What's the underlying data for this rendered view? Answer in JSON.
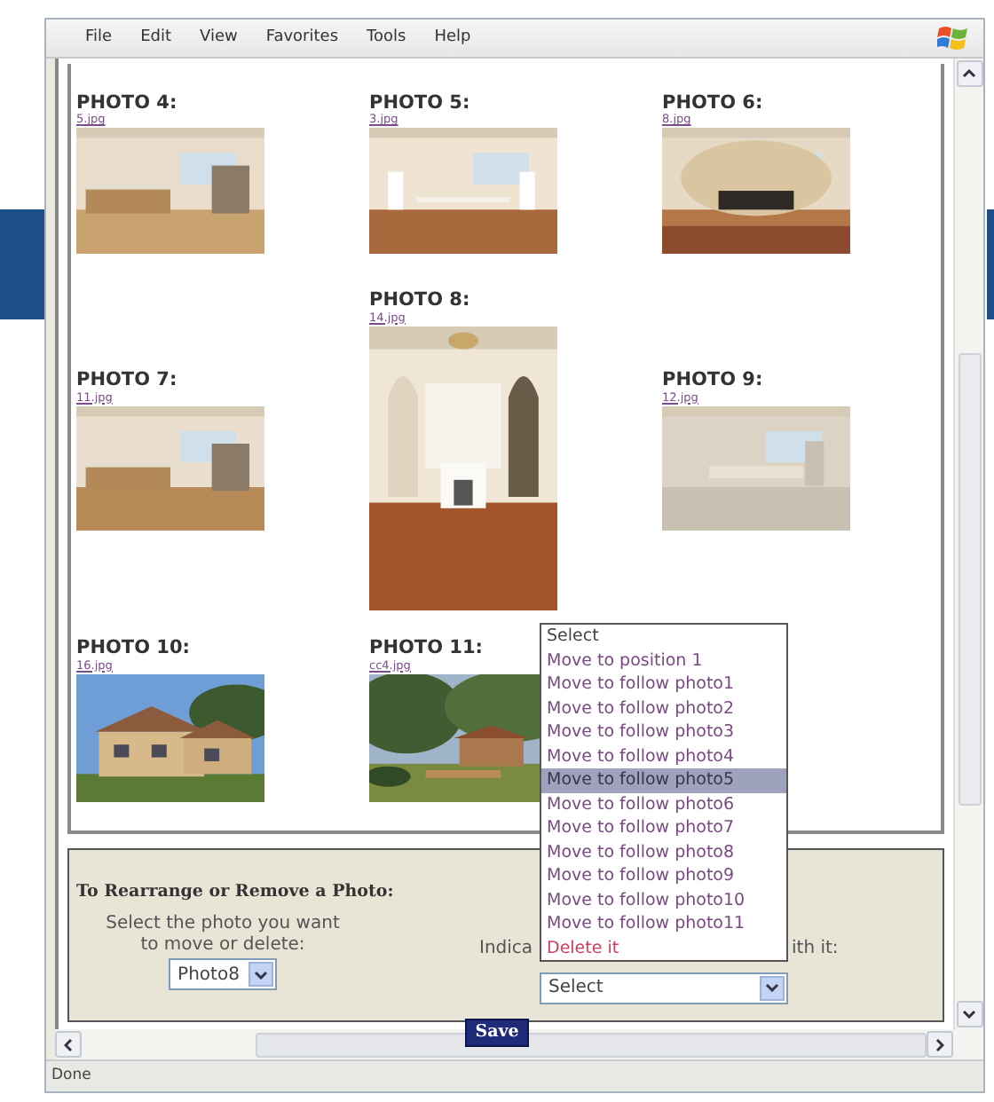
{
  "menu": [
    "File",
    "Edit",
    "View",
    "Favorites",
    "Tools",
    "Help"
  ],
  "photos": [
    {
      "title": "PHOTO 4:",
      "file": "5.jpg"
    },
    {
      "title": "PHOTO 5:",
      "file": "3.jpg"
    },
    {
      "title": "PHOTO 6:",
      "file": "8.jpg"
    },
    {
      "title": "PHOTO 7:",
      "file": "11.jpg"
    },
    {
      "title": "PHOTO 8:",
      "file": "14.jpg"
    },
    {
      "title": "PHOTO 9:",
      "file": "12.jpg"
    },
    {
      "title": "PHOTO 10:",
      "file": "16.jpg"
    },
    {
      "title": "PHOTO 11:",
      "file": "cc4.jpg"
    }
  ],
  "panel": {
    "title": "To Rearrange or Remove a Photo:",
    "instruction": "Select the photo you want to move or delete:",
    "photo_select": "Photo8",
    "label_left": "Indica",
    "action_select": "Select",
    "label_right": "ith it:",
    "save": "Save"
  },
  "action_options": [
    {
      "label": "Select",
      "kind": "placeholder",
      "selected": false
    },
    {
      "label": "Move to position 1",
      "kind": "move",
      "selected": false
    },
    {
      "label": "Move to follow photo1",
      "kind": "move",
      "selected": false
    },
    {
      "label": "Move to follow photo2",
      "kind": "move",
      "selected": false
    },
    {
      "label": "Move to follow photo3",
      "kind": "move",
      "selected": false
    },
    {
      "label": "Move to follow photo4",
      "kind": "move",
      "selected": false
    },
    {
      "label": "Move to follow photo5",
      "kind": "move",
      "selected": true
    },
    {
      "label": "Move to follow photo6",
      "kind": "move",
      "selected": false
    },
    {
      "label": "Move to follow photo7",
      "kind": "move",
      "selected": false
    },
    {
      "label": "Move to follow photo8",
      "kind": "move",
      "selected": false
    },
    {
      "label": "Move to follow photo9",
      "kind": "move",
      "selected": false
    },
    {
      "label": "Move to follow photo10",
      "kind": "move",
      "selected": false
    },
    {
      "label": "Move to follow photo11",
      "kind": "move",
      "selected": false
    },
    {
      "label": "Delete it",
      "kind": "delete",
      "selected": false
    }
  ],
  "status_bar": "Done"
}
